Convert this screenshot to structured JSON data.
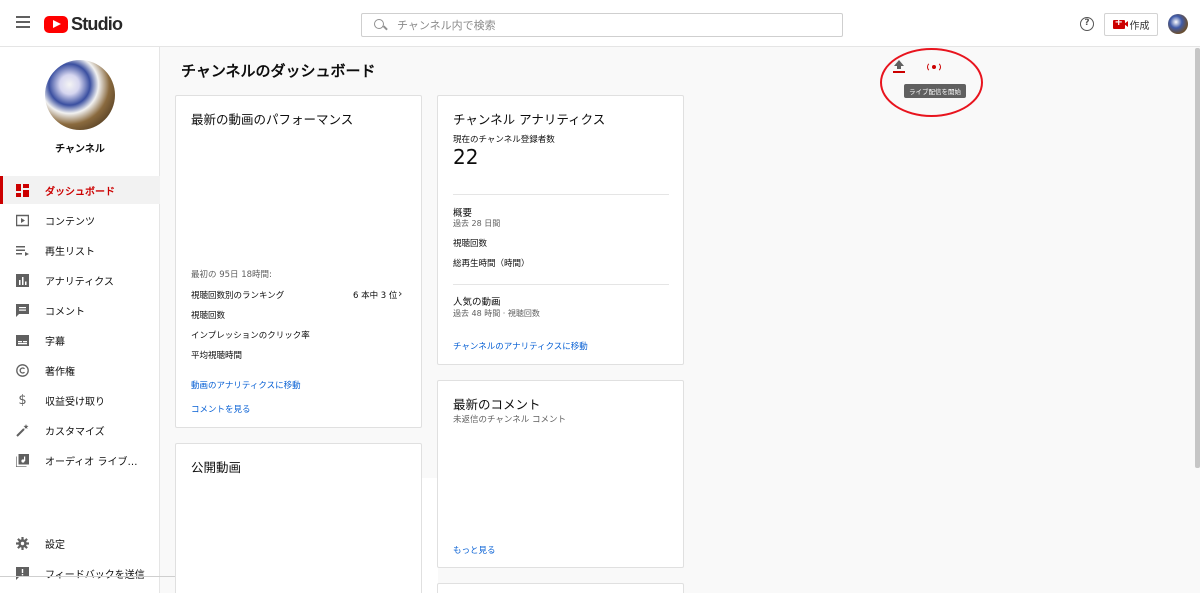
{
  "header": {
    "logo_text": "Studio",
    "search_placeholder": "チャンネル内で検索",
    "help_glyph": "?",
    "create_label": "作成"
  },
  "sidebar": {
    "channel_name": "チャンネル",
    "items": [
      {
        "label": "ダッシュボード",
        "icon": "dashboard-icon",
        "active": true
      },
      {
        "label": "コンテンツ",
        "icon": "content-icon"
      },
      {
        "label": "再生リスト",
        "icon": "playlist-icon"
      },
      {
        "label": "アナリティクス",
        "icon": "analytics-icon"
      },
      {
        "label": "コメント",
        "icon": "comment-icon"
      },
      {
        "label": "字幕",
        "icon": "subtitles-icon"
      },
      {
        "label": "著作権",
        "icon": "copyright-icon"
      },
      {
        "label": "収益受け取り",
        "icon": "dollar-icon"
      },
      {
        "label": "カスタマイズ",
        "icon": "magic-wand-icon"
      },
      {
        "label": "オーディオ ライブ…",
        "icon": "audio-library-icon"
      }
    ],
    "bottom_items": [
      {
        "label": "設定",
        "icon": "gear-icon"
      },
      {
        "label": "フィードバックを送信",
        "icon": "feedback-icon"
      }
    ]
  },
  "main": {
    "page_title": "チャンネルのダッシュボード",
    "live_tooltip": "ライブ配信を開始",
    "video_performance": {
      "title": "最新の動画のパフォーマンス",
      "period": "最初の 95日 18時間:",
      "ranking_label": "視聴回数別のランキング",
      "ranking_value": "6 本中 3 位",
      "metrics": [
        "視聴回数",
        "インプレッションのクリック率",
        "平均視聴時間"
      ],
      "analytics_link": "動画のアナリティクスに移動",
      "comments_link": "コメントを見る"
    },
    "published_videos": {
      "title": "公開動画"
    },
    "channel_analytics": {
      "title": "チャンネル アナリティクス",
      "subscribers_label": "現在のチャンネル登録者数",
      "subscribers_value": "22",
      "summary_title": "概要",
      "summary_period": "過去 28 日間",
      "summary_metrics": [
        "視聴回数",
        "総再生時間（時間）"
      ],
      "top_videos_title": "人気の動画",
      "top_videos_period": "過去 48 時間 · 視聴回数",
      "link": "チャンネルのアナリティクスに移動"
    },
    "latest_comments": {
      "title": "最新のコメント",
      "subtitle": "未返信のチャンネル コメント",
      "more_link": "もっと見る"
    }
  }
}
